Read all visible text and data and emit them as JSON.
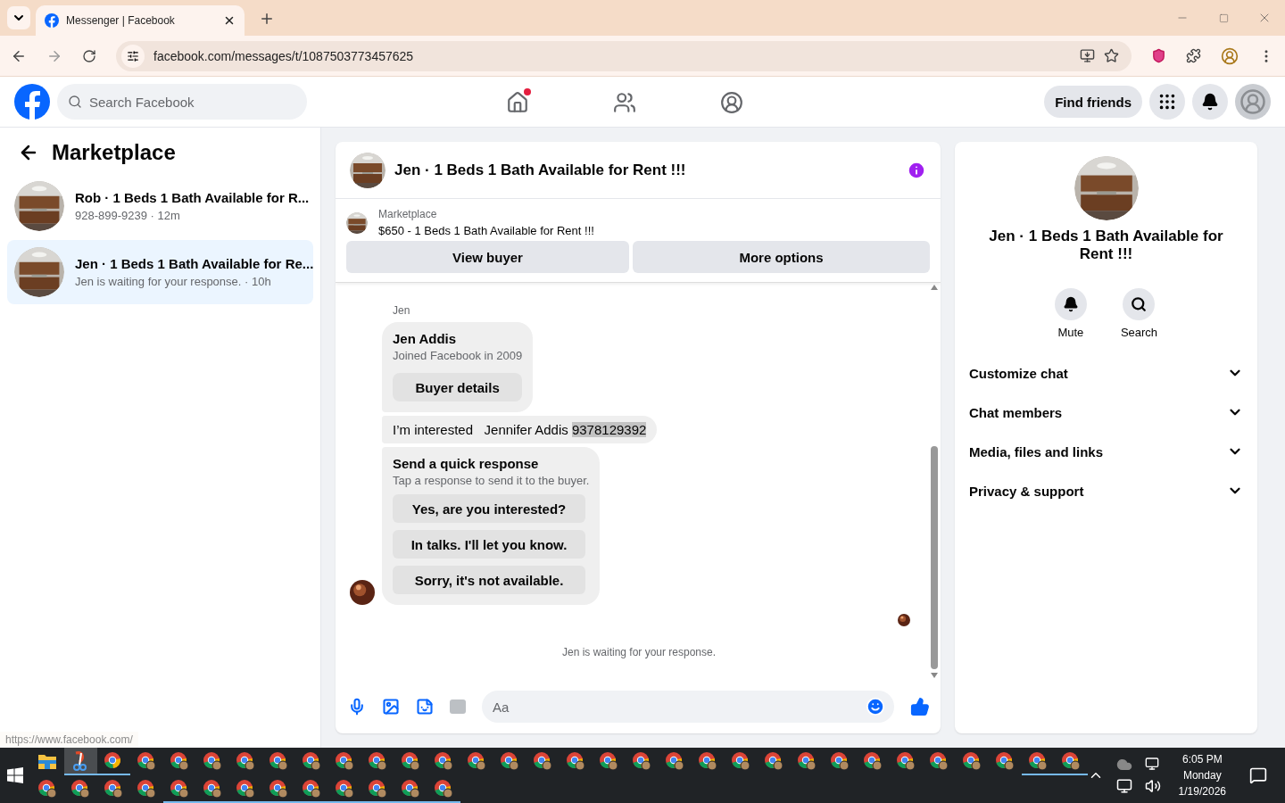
{
  "browser": {
    "tab": {
      "title": "Messenger | Facebook"
    },
    "url": "facebook.com/messages/t/1087503773457625"
  },
  "header": {
    "search": {
      "placeholder": "Search Facebook"
    },
    "home_notification": true,
    "find_friends": "Find friends"
  },
  "sidebar": {
    "title": "Marketplace",
    "conversations": [
      {
        "name": "Rob · 1 Beds 1 Bath Available for R...",
        "subtitle": "928-899-9239 · 12m",
        "selected": false
      },
      {
        "name": "Jen · 1 Beds 1 Bath Available for Re...",
        "subtitle": "Jen is waiting for your response. · 10h",
        "selected": true
      }
    ]
  },
  "chat": {
    "title": "Jen · 1 Beds 1 Bath Available for Rent !!!",
    "listing": {
      "label": "Marketplace",
      "text": "$650 - 1 Beds 1 Bath Available for Rent !!!"
    },
    "actions": [
      "View buyer",
      "More options"
    ],
    "sender": "Jen",
    "card": {
      "name": "Jen Addis",
      "subtitle": "Joined Facebook in 2009",
      "button": "Buyer details"
    },
    "message": {
      "text": "I’m interested   Jennifer Addis",
      "highlighted": "9378129392"
    },
    "quick": {
      "title": "Send a quick response",
      "subtitle": "Tap a response to send it to the buyer.",
      "options": [
        "Yes, are you interested?",
        "In talks. I'll let you know.",
        "Sorry, it's not available."
      ]
    },
    "status": "Jen is waiting for your response.",
    "composer": {
      "placeholder": "Aa"
    }
  },
  "details": {
    "title": "Jen · 1 Beds 1 Bath Available for Rent !!!",
    "actions": [
      "Mute",
      "Search"
    ],
    "sections": [
      "Customize chat",
      "Chat members",
      "Media, files and links",
      "Privacy & support"
    ]
  },
  "status_url": "https://www.facebook.com/",
  "taskbar": {
    "row_1": [
      {
        "kind": "explorer",
        "underlined": false,
        "active": false
      },
      {
        "kind": "snip",
        "underlined": true,
        "active": true
      },
      {
        "kind": "chrome",
        "underlined": true,
        "active": false
      },
      {
        "kind": "profile",
        "underlined": false,
        "active": false
      },
      {
        "kind": "profile",
        "underlined": false,
        "active": false
      },
      {
        "kind": "profile",
        "underlined": false,
        "active": false
      },
      {
        "kind": "profile",
        "underlined": false,
        "active": false
      },
      {
        "kind": "profile",
        "underlined": false,
        "active": false
      },
      {
        "kind": "profile",
        "underlined": false,
        "active": false
      },
      {
        "kind": "profile",
        "underlined": false,
        "active": false
      },
      {
        "kind": "profile",
        "underlined": false,
        "active": false
      },
      {
        "kind": "profile",
        "underlined": false,
        "active": false
      },
      {
        "kind": "profile",
        "underlined": false,
        "active": false
      },
      {
        "kind": "profile",
        "underlined": false,
        "active": false
      },
      {
        "kind": "profile",
        "underlined": false,
        "active": false
      },
      {
        "kind": "profile",
        "underlined": false,
        "active": false
      },
      {
        "kind": "profile",
        "underlined": false,
        "active": false
      },
      {
        "kind": "profile",
        "underlined": false,
        "active": false
      },
      {
        "kind": "profile",
        "underlined": false,
        "active": false
      },
      {
        "kind": "profile",
        "underlined": false,
        "active": false
      },
      {
        "kind": "profile",
        "underlined": false,
        "active": false
      },
      {
        "kind": "profile",
        "underlined": false,
        "active": false
      },
      {
        "kind": "profile",
        "underlined": false,
        "active": false
      },
      {
        "kind": "profile",
        "underlined": false,
        "active": false
      },
      {
        "kind": "profile",
        "underlined": false,
        "active": false
      },
      {
        "kind": "profile",
        "underlined": false,
        "active": false
      },
      {
        "kind": "profile",
        "underlined": false,
        "active": false
      },
      {
        "kind": "profile",
        "underlined": false,
        "active": false
      },
      {
        "kind": "profile",
        "underlined": false,
        "active": false
      },
      {
        "kind": "profile",
        "underlined": false,
        "active": false
      },
      {
        "kind": "profile",
        "underlined": true,
        "active": false
      },
      {
        "kind": "profile",
        "underlined": true,
        "active": false
      }
    ],
    "row_2": [
      {
        "kind": "profile",
        "underlined": false,
        "active": false
      },
      {
        "kind": "profile",
        "underlined": false,
        "active": false
      },
      {
        "kind": "profile",
        "underlined": false,
        "active": false
      },
      {
        "kind": "profile",
        "underlined": false,
        "active": false
      },
      {
        "kind": "profile",
        "underlined": true,
        "active": false
      },
      {
        "kind": "profile",
        "underlined": true,
        "active": false
      },
      {
        "kind": "profile",
        "underlined": true,
        "active": false
      },
      {
        "kind": "profile",
        "underlined": true,
        "active": false
      },
      {
        "kind": "profile",
        "underlined": true,
        "active": false
      },
      {
        "kind": "profile",
        "underlined": true,
        "active": false
      },
      {
        "kind": "profile",
        "underlined": true,
        "active": false
      },
      {
        "kind": "profile",
        "underlined": true,
        "active": false
      },
      {
        "kind": "profile",
        "underlined": true,
        "active": false
      }
    ],
    "clock": {
      "time": "6:05 PM",
      "day": "Monday",
      "date": "1/19/2026"
    }
  }
}
